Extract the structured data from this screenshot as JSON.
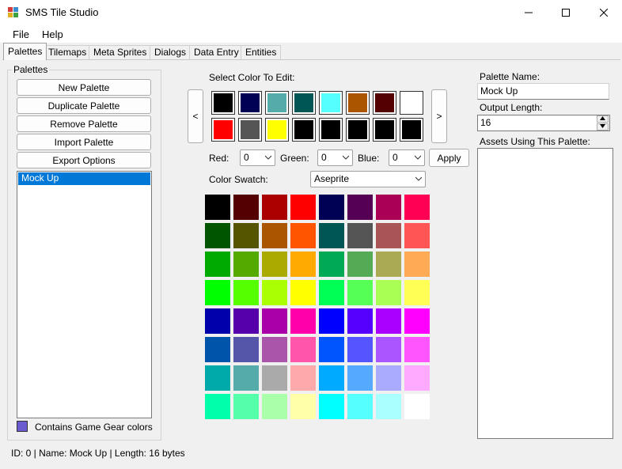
{
  "window": {
    "title": "SMS Tile Studio"
  },
  "menu": [
    "File",
    "Help"
  ],
  "tabs": [
    "Palettes",
    "Tilemaps",
    "Meta Sprites",
    "Dialogs",
    "Data Entry",
    "Entities"
  ],
  "palettes_group": {
    "legend": "Palettes",
    "buttons": [
      "New Palette",
      "Duplicate Palette",
      "Remove Palette",
      "Import Palette",
      "Export Options"
    ],
    "list_items": [
      "Mock Up"
    ],
    "selected_item": "Mock Up",
    "gamegear_label": "Contains Game Gear colors"
  },
  "editor": {
    "select_label": "Select Color To Edit:",
    "prev_label": "<",
    "next_label": ">",
    "palette_colors": [
      "#000000",
      "#000055",
      "#55aaaa",
      "#005555",
      "#55ffff",
      "#aa5500",
      "#550000",
      "#ffffff",
      "#ff0000",
      "#555555",
      "#ffff00",
      "#000000",
      "#000000",
      "#000000",
      "#000000",
      "#000000"
    ],
    "red_label": "Red:",
    "red_value": "0",
    "green_label": "Green:",
    "green_value": "0",
    "blue_label": "Blue:",
    "blue_value": "0",
    "apply_label": "Apply",
    "swatch_label": "Color Swatch:",
    "swatch_value": "Aseprite",
    "swatch_grid": [
      [
        "#000000",
        "#550000",
        "#aa0000",
        "#ff0000",
        "#000055",
        "#550055",
        "#aa0055",
        "#ff0055"
      ],
      [
        "#005500",
        "#555500",
        "#aa5500",
        "#ff5500",
        "#005555",
        "#555555",
        "#aa5555",
        "#ff5555"
      ],
      [
        "#00aa00",
        "#55aa00",
        "#aaaa00",
        "#ffaa00",
        "#00aa55",
        "#55aa55",
        "#aaaa55",
        "#ffaa55"
      ],
      [
        "#00ff00",
        "#55ff00",
        "#aaff00",
        "#ffff00",
        "#00ff55",
        "#55ff55",
        "#aaff55",
        "#ffff55"
      ],
      [
        "#0000aa",
        "#5500aa",
        "#aa00aa",
        "#ff00aa",
        "#0000ff",
        "#5500ff",
        "#aa00ff",
        "#ff00ff"
      ],
      [
        "#0055aa",
        "#5555aa",
        "#aa55aa",
        "#ff55aa",
        "#0055ff",
        "#5555ff",
        "#aa55ff",
        "#ff55ff"
      ],
      [
        "#00aaaa",
        "#55aaaa",
        "#aaaaaa",
        "#ffaaaa",
        "#00aaff",
        "#55aaff",
        "#aaaaff",
        "#ffaaff"
      ],
      [
        "#00ffaa",
        "#55ffaa",
        "#aaffaa",
        "#ffffaa",
        "#00ffff",
        "#55ffff",
        "#aaffff",
        "#ffffff"
      ]
    ]
  },
  "right": {
    "name_label": "Palette Name:",
    "name_value": "Mock Up",
    "output_label": "Output Length:",
    "output_value": "16",
    "assets_label": "Assets Using This Palette:"
  },
  "status": "ID: 0 | Name: Mock Up | Length: 16 bytes",
  "colors": {
    "selection": "#0078d7",
    "gamegear_swatch": "#6b5bd1"
  }
}
